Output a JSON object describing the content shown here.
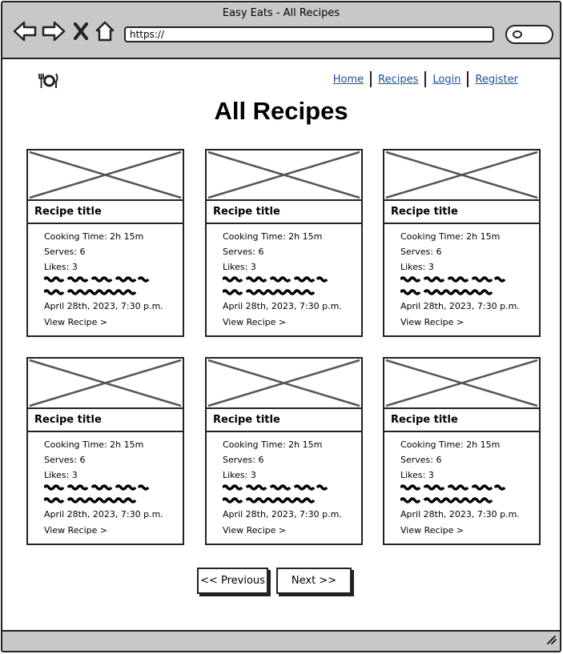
{
  "browser": {
    "window_title": "Easy Eats - All Recipes",
    "url": "https://"
  },
  "site": {
    "logo_icon": "utensils-plate-icon",
    "nav": [
      "Home",
      "Recipes",
      "Login",
      "Register"
    ],
    "nav_color": "#1a4f9c"
  },
  "page": {
    "title": "All Recipes"
  },
  "recipes": [
    {
      "title": "Recipe title",
      "cooking_time": "Cooking Time: 2h 15m",
      "serves": "Serves: 6",
      "likes": "Likes: 3",
      "date": "April 28th, 2023, 7:30 p.m.",
      "link": "View Recipe >"
    },
    {
      "title": "Recipe title",
      "cooking_time": "Cooking Time: 2h 15m",
      "serves": "Serves: 6",
      "likes": "Likes: 3",
      "date": "April 28th, 2023, 7:30 p.m.",
      "link": "View Recipe >"
    },
    {
      "title": "Recipe title",
      "cooking_time": "Cooking Time: 2h 15m",
      "serves": "Serves: 6",
      "likes": "Likes: 3",
      "date": "April 28th, 2023, 7:30 p.m.",
      "link": "View Recipe >"
    },
    {
      "title": "Recipe title",
      "cooking_time": "Cooking Time: 2h 15m",
      "serves": "Serves: 6",
      "likes": "Likes: 3",
      "date": "April 28th, 2023, 7:30 p.m.",
      "link": "View Recipe >"
    },
    {
      "title": "Recipe title",
      "cooking_time": "Cooking Time: 2h 15m",
      "serves": "Serves: 6",
      "likes": "Likes: 3",
      "date": "April 28th, 2023, 7:30 p.m.",
      "link": "View Recipe >"
    },
    {
      "title": "Recipe title",
      "cooking_time": "Cooking Time: 2h 15m",
      "serves": "Serves: 6",
      "likes": "Likes: 3",
      "date": "April 28th, 2023, 7:30 p.m.",
      "link": "View Recipe >"
    }
  ],
  "pagination": {
    "previous": "<< Previous",
    "next": "Next >>"
  }
}
